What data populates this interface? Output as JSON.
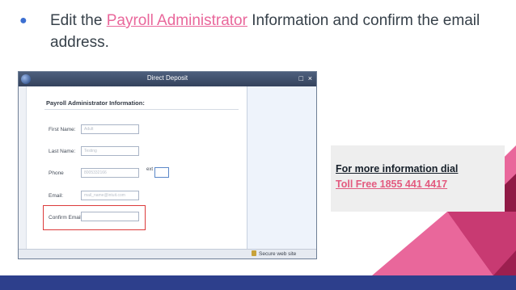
{
  "bullet": {
    "before": "Edit the ",
    "link": "Payroll Administrator",
    "after": " Information and confirm the email address."
  },
  "screenshot": {
    "window_title": "Direct Deposit",
    "minimize_glyph": "□",
    "close_glyph": "×",
    "form_heading": "Payroll Administrator Information:",
    "fields": [
      {
        "label": "First Name:",
        "value": "Adult"
      },
      {
        "label": "Last Name:",
        "value": "Testing"
      },
      {
        "label": "Phone",
        "value": "8005332166"
      },
      {
        "label": "Email:",
        "value": "mail_name@intuit.com"
      },
      {
        "label": "Confirm Email:",
        "value": ""
      }
    ],
    "ext_label": "ext",
    "status_text": "Secure web site"
  },
  "info": {
    "line1": "For more information dial",
    "line2": "Toll Free 1855 441 4417"
  },
  "colors": {
    "accent_pink": "#e9679b",
    "deep_magenta": "#9c1f4f",
    "navy_band": "#2d3f8c",
    "highlight_red": "#dc3b3b"
  }
}
